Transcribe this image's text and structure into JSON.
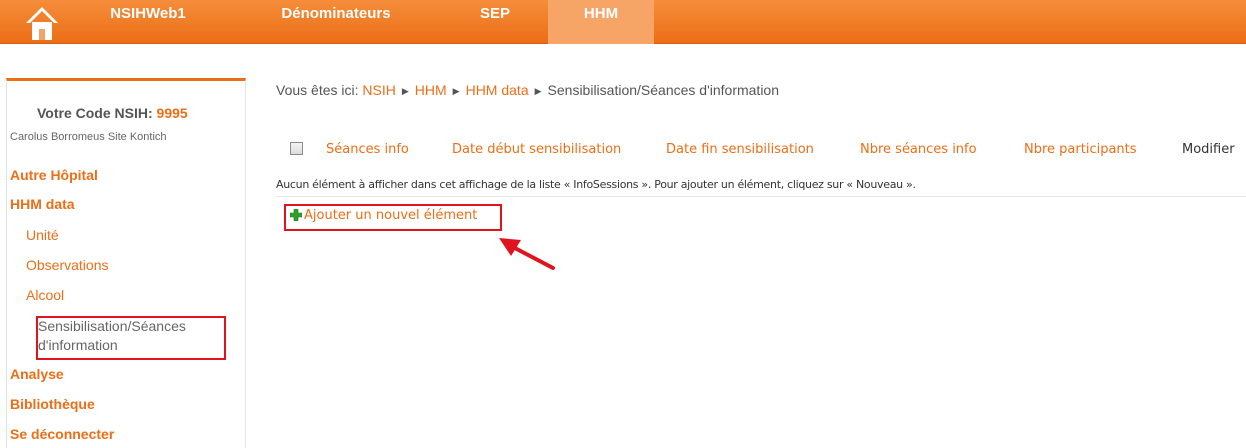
{
  "topbar": {
    "nav": [
      {
        "label": "NSIHWeb1"
      },
      {
        "label": "Dénominateurs"
      },
      {
        "label": "SEP"
      },
      {
        "label": "HHM",
        "active": true
      }
    ],
    "home_icon": "home-icon",
    "color": "#ec6e16"
  },
  "sidebar": {
    "code_label": "Votre Code NSIH:",
    "code_value": "9995",
    "site": "Carolus Borromeus Site Kontich",
    "items": [
      {
        "label": "Autre Hôpital"
      },
      {
        "label": "HHM data"
      },
      {
        "label": "Unité"
      },
      {
        "label": "Observations"
      },
      {
        "label": "Alcool"
      },
      {
        "label": "Sensibilisation/Séances d'information"
      },
      {
        "label": "Analyse"
      },
      {
        "label": "Bibliothèque"
      },
      {
        "label": "Se déconnecter"
      }
    ]
  },
  "breadcrumb": {
    "prefix": "Vous êtes ici:",
    "items": [
      "NSIH",
      "HHM",
      "HHM data",
      "Sensibilisation/Séances d'information"
    ]
  },
  "list": {
    "columns": [
      "Séances info",
      "Date début sensibilisation",
      "Date fin sensibilisation",
      "Nbre séances info",
      "Nbre participants",
      "Modifier"
    ],
    "empty_message": "Aucun élément à afficher dans cet affichage de la liste « InfoSessions ». Pour ajouter un élément, cliquez sur « Nouveau ».",
    "add_label": "Ajouter un nouvel élément"
  },
  "annotations": {
    "highlight_color": "#e0141e"
  }
}
